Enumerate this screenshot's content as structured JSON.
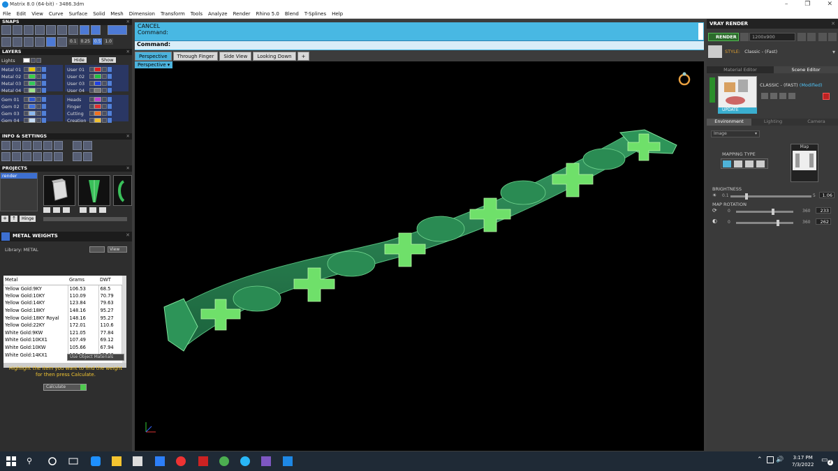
{
  "window": {
    "title": "Matrix 8.0 (64-bit) - 3486.3dm"
  },
  "menu": [
    "File",
    "Edit",
    "View",
    "Curve",
    "Surface",
    "Solid",
    "Mesh",
    "Dimension",
    "Transform",
    "Tools",
    "Analyze",
    "Render",
    "Rhino 5.0",
    "Blend",
    "T-Splines",
    "Help"
  ],
  "left": {
    "snaps_title": "SNAPS",
    "snaps_values": [
      "0.1",
      "0.25",
      "0.5",
      "1.0"
    ],
    "layers_title": "LAYERS",
    "hide_label": "Hide",
    "show_label": "Show",
    "lights_label": "Lights",
    "layers_left": [
      {
        "name": "Metal 01",
        "color": "#e8c300"
      },
      {
        "name": "Metal 02",
        "color": "#38d04a"
      },
      {
        "name": "Metal 03",
        "color": "#32c95a"
      },
      {
        "name": "Metal 04",
        "color": "#9ce38a"
      },
      {
        "name": "Gem 01",
        "color": "#2e56cf"
      },
      {
        "name": "Gem 02",
        "color": "#3c6fe0"
      },
      {
        "name": "Gem 03",
        "color": "#8ab8ef"
      },
      {
        "name": "Gem 04",
        "color": "#c5dcf5"
      }
    ],
    "layers_right": [
      {
        "name": "User 01",
        "color": "#e02020"
      },
      {
        "name": "User 02",
        "color": "#20c040"
      },
      {
        "name": "User 03",
        "color": "#2040e0"
      },
      {
        "name": "User 04",
        "color": "#777777"
      },
      {
        "name": "Heads",
        "color": "#c040d0"
      },
      {
        "name": "Finger",
        "color": "#e03030"
      },
      {
        "name": "Cutting",
        "color": "#f07020"
      },
      {
        "name": "Creation",
        "color": "#f0c030"
      }
    ],
    "info_title": "INFO & SETTINGS",
    "projects_title": "PROJECTS",
    "project_item": "render",
    "project_numbers": [
      "1",
      "2",
      "3"
    ],
    "hinge_label": "Hinge",
    "metal_weights_title": "METAL WEIGHTS",
    "library_label": "Library: METAL",
    "view_label": "View",
    "columns": [
      "Metal",
      "Grams",
      "DWT"
    ],
    "rows": [
      [
        "Yellow Gold:9KY",
        "106.53",
        "68.5"
      ],
      [
        "Yellow Gold:10KY",
        "110.09",
        "70.79"
      ],
      [
        "Yellow Gold:14KY",
        "123.84",
        "79.63"
      ],
      [
        "Yellow Gold:18KY",
        "148.16",
        "95.27"
      ],
      [
        "Yellow Gold:18KY Royal",
        "148.16",
        "95.27"
      ],
      [
        "Yellow Gold:22KY",
        "172.01",
        "110.6"
      ],
      [
        "White Gold:9KW",
        "121.05",
        "77.84"
      ],
      [
        "White Gold:10KX1",
        "107.49",
        "69.12"
      ],
      [
        "White Gold:10KW",
        "105.66",
        "67.94"
      ],
      [
        "White Gold:14KX1",
        "121.24",
        "77.96"
      ]
    ],
    "use_object_materials": "Use Object Materials",
    "hint": "Highlight the item you want to find the weight for then press Calculate.",
    "calculate": "Calculate"
  },
  "center": {
    "cancel": "CANCEL",
    "command_hist": "Command:",
    "command_prompt": "Command:",
    "tabs": [
      "Perspective",
      "Through Finger",
      "Side View",
      "Looking Down"
    ],
    "plus": "+",
    "viewport_label": "Perspective"
  },
  "right": {
    "title": "VRAY RENDER",
    "render_btn": "RENDER",
    "resolution": "1200x900",
    "style_label": "STYLE:",
    "style_value": "Classic - (Fast)",
    "tab_material": "Material Editor",
    "tab_scene": "Scene Editor",
    "preset": "CLASSIC - (FAST)",
    "modified": "(Modified)",
    "update": "UPDATE",
    "env_tabs": [
      "Environment",
      "Lighting",
      "Camera"
    ],
    "env_type": "Image",
    "mapping_type": "MAPPING TYPE",
    "map_label": "Map",
    "brightness_label": "BRIGHTNESS",
    "brightness": {
      "min": "0.1",
      "max": "5",
      "value": "1.06",
      "fraction": 0.2
    },
    "map_rotation_label": "MAP ROTATION",
    "rot1": {
      "min": "0",
      "max": "360",
      "value": "233",
      "fraction": 0.647
    },
    "rot2": {
      "min": "0",
      "max": "360",
      "value": "262",
      "fraction": 0.728
    }
  },
  "taskbar": {
    "time": "3:17 PM",
    "date": "7/3/2022",
    "badge": "2"
  }
}
